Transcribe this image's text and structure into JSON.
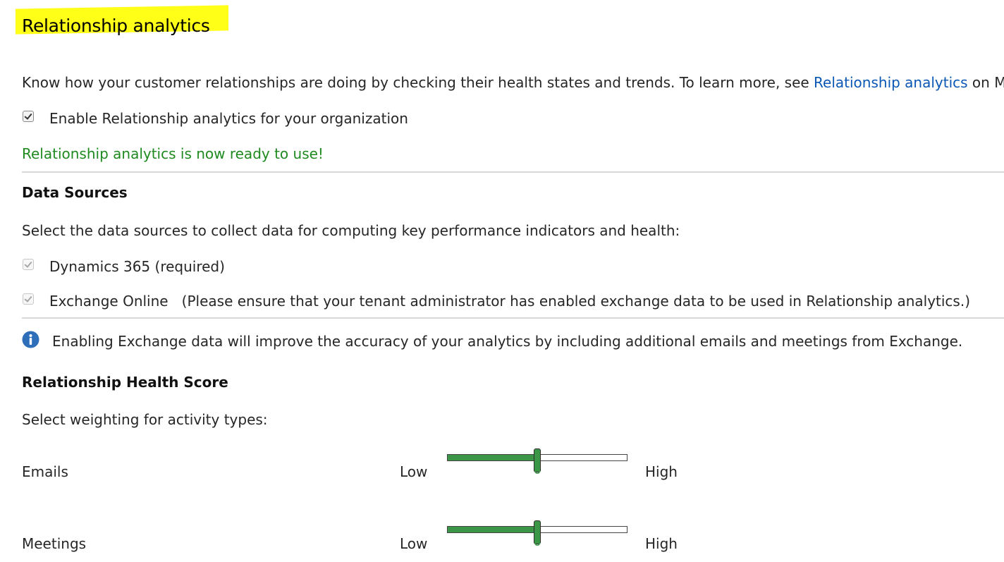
{
  "page": {
    "title": "Relationship analytics",
    "intro_text": "Know how your customer relationships are doing by checking their health states and trends. To learn more, see ",
    "intro_link": "Relationship analytics",
    "intro_suffix": " on Micr",
    "enable_label": "Enable Relationship analytics for your organization",
    "enable_checked": true,
    "status_message": "Relationship analytics is now ready to use!",
    "accent_color": "#3b9747",
    "link_color": "#0b57b5",
    "highlight_color": "#ffff17"
  },
  "data_sources": {
    "heading": "Data Sources",
    "description": "Select the data sources to collect data for computing key performance indicators and health:",
    "items": [
      {
        "label": "Dynamics 365 (required)",
        "checked": true,
        "disabled": true
      },
      {
        "label": "Exchange Online   (Please ensure that your tenant administrator has enabled exchange data to be used in Relationship analytics.)",
        "checked": true,
        "disabled": true
      }
    ],
    "info_icon": "info-icon",
    "info_text": "Enabling Exchange data will improve the accuracy of your analytics by including additional emails and meetings from Exchange."
  },
  "health_score": {
    "heading": "Relationship Health Score",
    "description": "Select weighting for activity types:",
    "low_label": "Low",
    "high_label": "High",
    "sliders": [
      {
        "name": "Emails",
        "value": "6",
        "fraction": 0.5
      },
      {
        "name": "Meetings",
        "value": "6",
        "fraction": 0.5
      }
    ]
  }
}
